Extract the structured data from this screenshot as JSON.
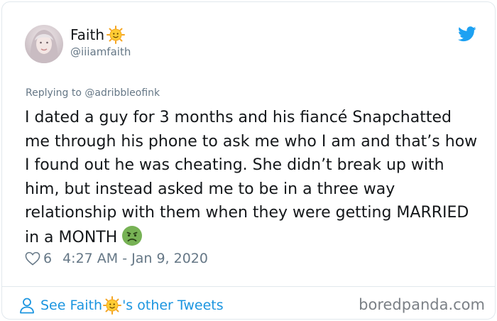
{
  "tweet": {
    "display_name": "Faith",
    "handle": "@iiiamfaith",
    "replying_to_prefix": "Replying to ",
    "replying_to_handle": "@adribbleofink",
    "text": "I dated a guy for 3 months and his fiancé Snapchatted me through his phone to ask me who I am and that’s how I found out he was cheating. She didn’t break up with him, but instead asked me to be in a three way relationship with them when they were getting MARRIED in a MONTH",
    "likes": "6",
    "timestamp": "4:27 AM - Jan 9, 2020"
  },
  "footer": {
    "see_prefix": "See Faith",
    "see_suffix": "'s other Tweets",
    "watermark": "boredpanda.com"
  },
  "icons": {
    "name_emoji": "sun-face-icon",
    "text_emoji": "nauseated-face-icon",
    "brand": "twitter-bird-icon"
  },
  "colors": {
    "link_blue": "#1b95e0",
    "twitter_blue": "#1da1f2",
    "muted": "#657786",
    "text": "#14171a",
    "border": "#e1e8ed"
  }
}
